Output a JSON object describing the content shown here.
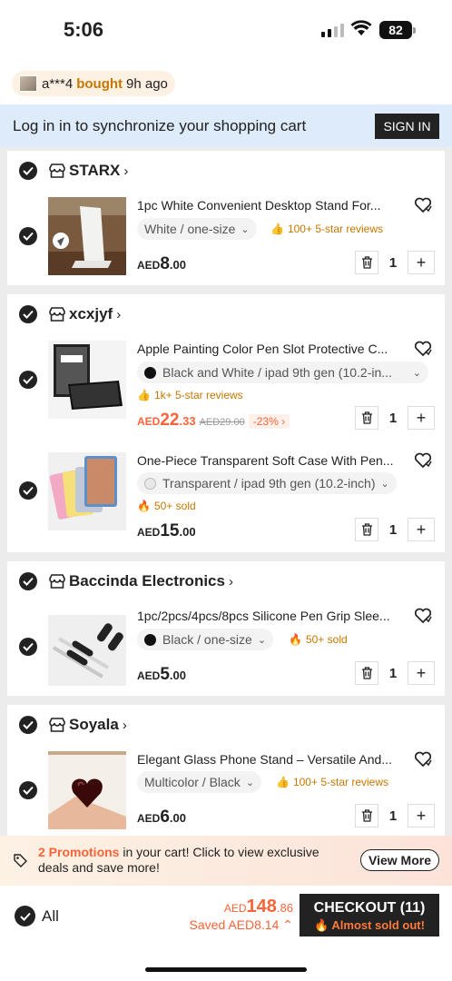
{
  "status_bar": {
    "time": "5:06",
    "battery": "82"
  },
  "ticker": {
    "user": "a***4",
    "action": "bought",
    "when": "9h ago"
  },
  "login_banner": {
    "text": "Log in in to synchronize your shopping cart",
    "button": "SIGN IN"
  },
  "stores": [
    {
      "name": "STARX",
      "items": [
        {
          "title": "1pc White Convenient Desktop Stand For...",
          "variant": "White / one-size",
          "tag": "100+ 5-star reviews",
          "price_cur": "AED",
          "price_int": "8",
          "price_dec": ".00",
          "qty": "1"
        }
      ]
    },
    {
      "name": "xcxjyf",
      "items": [
        {
          "title": "Apple Painting Color Pen Slot Protective C...",
          "variant": "Black and White / ipad 9th gen (10.2-in...",
          "tag": "1k+ 5-star reviews",
          "price_cur": "AED",
          "price_int": "22",
          "price_dec": ".33",
          "orig": "AED29.00",
          "discount": "-23%",
          "qty": "1"
        },
        {
          "title": "One-Piece Transparent Soft Case With Pen...",
          "variant": "Transparent / ipad 9th gen (10.2-inch)",
          "tag": "50+ sold",
          "price_cur": "AED",
          "price_int": "15",
          "price_dec": ".00",
          "qty": "1"
        }
      ]
    },
    {
      "name": "Baccinda Electronics",
      "items": [
        {
          "title": "1pc/2pcs/4pcs/8pcs Silicone Pen Grip Slee...",
          "variant": "Black / one-size",
          "tag": "50+ sold",
          "price_cur": "AED",
          "price_int": "5",
          "price_dec": ".00",
          "qty": "1"
        }
      ]
    },
    {
      "name": "Soyala",
      "items": [
        {
          "title": "Elegant Glass Phone Stand – Versatile And...",
          "variant": "Multicolor / Black",
          "tag": "100+ 5-star reviews",
          "price_cur": "AED",
          "price_int": "6",
          "price_dec": ".00",
          "qty": "1"
        }
      ]
    }
  ],
  "promo": {
    "count_text": "2 Promotions",
    "rest": " in your cart! Click to view exclusive",
    "line2": "deals and save more!",
    "button": "View More"
  },
  "bottom_bar": {
    "all_label": "All",
    "total_cur": "AED",
    "total_int": "148",
    "total_dec": ".86",
    "saved": "Saved AED8.14 ⌃",
    "checkout": "CHECKOUT (11)",
    "checkout_sub": "Almost sold out!"
  },
  "colors": {
    "accent": "#fa6338",
    "tag_orange": "#c77700",
    "dark": "#222222",
    "login_bg": "#ddebfb"
  }
}
